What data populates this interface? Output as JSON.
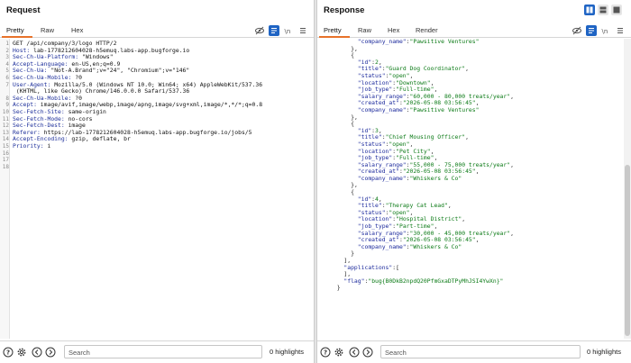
{
  "request": {
    "title": "Request",
    "tabs": [
      "Pretty",
      "Raw",
      "Hex"
    ],
    "line_numbers": [
      "1",
      "2",
      "3",
      "4",
      "5",
      "6",
      "7",
      "",
      "8",
      "9",
      "10",
      "11",
      "12",
      "13",
      "14",
      "15",
      "16",
      "17",
      "18"
    ],
    "lines": [
      {
        "k": "",
        "v": "GET /api/company/3/logo HTTP/2"
      },
      {
        "k": "Host",
        "v": " lab-1778212604028-h5emuq.labs-app.bugforge.io"
      },
      {
        "k": "Sec-Ch-Ua-Platform",
        "v": " \"Windows\""
      },
      {
        "k": "Accept-Language",
        "v": " en-US,en;q=0.9"
      },
      {
        "k": "Sec-Ch-Ua",
        "v": " \"Not-A.Brand\";v=\"24\", \"Chromium\";v=\"146\""
      },
      {
        "k": "Sec-Ch-Ua-Mobile",
        "v": " ?0"
      },
      {
        "k": "User-Agent",
        "v": " Mozilla/5.0 (Windows NT 10.0; Win64; x64) AppleWebKit/537.36"
      },
      {
        "k": "",
        "v": " (KHTML, like Gecko) Chrome/146.0.0.0 Safari/537.36"
      },
      {
        "k": "Sec-Ch-Ua-Mobile",
        "v": " ?0"
      },
      {
        "k": "Accept",
        "v": " image/avif,image/webp,image/apng,image/svg+xml,image/*,*/*;q=0.8"
      },
      {
        "k": "Sec-Fetch-Site",
        "v": " same-origin"
      },
      {
        "k": "Sec-Fetch-Mode",
        "v": " no-cors"
      },
      {
        "k": "Sec-Fetch-Dest",
        "v": " image"
      },
      {
        "k": "Referer",
        "v": " https://lab-1778212604028-h5emuq.labs-app.bugforge.io/jobs/5"
      },
      {
        "k": "Accept-Encoding",
        "v": " gzip, deflate, br"
      },
      {
        "k": "Priority",
        "v": " i"
      },
      {
        "k": "",
        "v": ""
      },
      {
        "k": "",
        "v": ""
      },
      {
        "k": "",
        "v": ""
      }
    ],
    "search_placeholder": "Search",
    "highlights": "0 highlights"
  },
  "response": {
    "title": "Response",
    "tabs": [
      "Pretty",
      "Raw",
      "Hex",
      "Render"
    ],
    "json_lines": [
      [
        [
          "i",
          "        "
        ],
        [
          "k",
          "\"company_name\""
        ],
        [
          "p",
          ":"
        ],
        [
          "s",
          "\"Pawsitive Ventures\""
        ]
      ],
      [
        [
          "i",
          "      "
        ],
        [
          "p",
          "},"
        ]
      ],
      [
        [
          "i",
          "      "
        ],
        [
          "p",
          "{"
        ]
      ],
      [
        [
          "i",
          "        "
        ],
        [
          "k",
          "\"id\""
        ],
        [
          "p",
          ":"
        ],
        [
          "n",
          "2"
        ],
        [
          "p",
          ","
        ]
      ],
      [
        [
          "i",
          "        "
        ],
        [
          "k",
          "\"title\""
        ],
        [
          "p",
          ":"
        ],
        [
          "s",
          "\"Guard Dog Coordinator\""
        ],
        [
          "p",
          ","
        ]
      ],
      [
        [
          "i",
          "        "
        ],
        [
          "k",
          "\"status\""
        ],
        [
          "p",
          ":"
        ],
        [
          "s",
          "\"open\""
        ],
        [
          "p",
          ","
        ]
      ],
      [
        [
          "i",
          "        "
        ],
        [
          "k",
          "\"location\""
        ],
        [
          "p",
          ":"
        ],
        [
          "s",
          "\"Downtown\""
        ],
        [
          "p",
          ","
        ]
      ],
      [
        [
          "i",
          "        "
        ],
        [
          "k",
          "\"job_type\""
        ],
        [
          "p",
          ":"
        ],
        [
          "s",
          "\"Full-time\""
        ],
        [
          "p",
          ","
        ]
      ],
      [
        [
          "i",
          "        "
        ],
        [
          "k",
          "\"salary_range\""
        ],
        [
          "p",
          ":"
        ],
        [
          "s",
          "\"60,000 - 80,000 treats/year\""
        ],
        [
          "p",
          ","
        ]
      ],
      [
        [
          "i",
          "        "
        ],
        [
          "k",
          "\"created_at\""
        ],
        [
          "p",
          ":"
        ],
        [
          "s",
          "\"2026-05-08 03:56:45\""
        ],
        [
          "p",
          ","
        ]
      ],
      [
        [
          "i",
          "        "
        ],
        [
          "k",
          "\"company_name\""
        ],
        [
          "p",
          ":"
        ],
        [
          "s",
          "\"Pawsitive Ventures\""
        ]
      ],
      [
        [
          "i",
          "      "
        ],
        [
          "p",
          "},"
        ]
      ],
      [
        [
          "i",
          "      "
        ],
        [
          "p",
          "{"
        ]
      ],
      [
        [
          "i",
          "        "
        ],
        [
          "k",
          "\"id\""
        ],
        [
          "p",
          ":"
        ],
        [
          "n",
          "3"
        ],
        [
          "p",
          ","
        ]
      ],
      [
        [
          "i",
          "        "
        ],
        [
          "k",
          "\"title\""
        ],
        [
          "p",
          ":"
        ],
        [
          "s",
          "\"Chief Mousing Officer\""
        ],
        [
          "p",
          ","
        ]
      ],
      [
        [
          "i",
          "        "
        ],
        [
          "k",
          "\"status\""
        ],
        [
          "p",
          ":"
        ],
        [
          "s",
          "\"open\""
        ],
        [
          "p",
          ","
        ]
      ],
      [
        [
          "i",
          "        "
        ],
        [
          "k",
          "\"location\""
        ],
        [
          "p",
          ":"
        ],
        [
          "s",
          "\"Pet City\""
        ],
        [
          "p",
          ","
        ]
      ],
      [
        [
          "i",
          "        "
        ],
        [
          "k",
          "\"job_type\""
        ],
        [
          "p",
          ":"
        ],
        [
          "s",
          "\"Full-time\""
        ],
        [
          "p",
          ","
        ]
      ],
      [
        [
          "i",
          "        "
        ],
        [
          "k",
          "\"salary_range\""
        ],
        [
          "p",
          ":"
        ],
        [
          "s",
          "\"55,000 - 75,000 treats/year\""
        ],
        [
          "p",
          ","
        ]
      ],
      [
        [
          "i",
          "        "
        ],
        [
          "k",
          "\"created_at\""
        ],
        [
          "p",
          ":"
        ],
        [
          "s",
          "\"2026-05-08 03:56:45\""
        ],
        [
          "p",
          ","
        ]
      ],
      [
        [
          "i",
          "        "
        ],
        [
          "k",
          "\"company_name\""
        ],
        [
          "p",
          ":"
        ],
        [
          "s",
          "\"Whiskers & Co\""
        ]
      ],
      [
        [
          "i",
          "      "
        ],
        [
          "p",
          "},"
        ]
      ],
      [
        [
          "i",
          "      "
        ],
        [
          "p",
          "{"
        ]
      ],
      [
        [
          "i",
          "        "
        ],
        [
          "k",
          "\"id\""
        ],
        [
          "p",
          ":"
        ],
        [
          "n",
          "4"
        ],
        [
          "p",
          ","
        ]
      ],
      [
        [
          "i",
          "        "
        ],
        [
          "k",
          "\"title\""
        ],
        [
          "p",
          ":"
        ],
        [
          "s",
          "\"Therapy Cat Lead\""
        ],
        [
          "p",
          ","
        ]
      ],
      [
        [
          "i",
          "        "
        ],
        [
          "k",
          "\"status\""
        ],
        [
          "p",
          ":"
        ],
        [
          "s",
          "\"open\""
        ],
        [
          "p",
          ","
        ]
      ],
      [
        [
          "i",
          "        "
        ],
        [
          "k",
          "\"location\""
        ],
        [
          "p",
          ":"
        ],
        [
          "s",
          "\"Hospital District\""
        ],
        [
          "p",
          ","
        ]
      ],
      [
        [
          "i",
          "        "
        ],
        [
          "k",
          "\"job_type\""
        ],
        [
          "p",
          ":"
        ],
        [
          "s",
          "\"Part-time\""
        ],
        [
          "p",
          ","
        ]
      ],
      [
        [
          "i",
          "        "
        ],
        [
          "k",
          "\"salary_range\""
        ],
        [
          "p",
          ":"
        ],
        [
          "s",
          "\"30,000 - 45,000 treats/year\""
        ],
        [
          "p",
          ","
        ]
      ],
      [
        [
          "i",
          "        "
        ],
        [
          "k",
          "\"created_at\""
        ],
        [
          "p",
          ":"
        ],
        [
          "s",
          "\"2026-05-08 03:56:45\""
        ],
        [
          "p",
          ","
        ]
      ],
      [
        [
          "i",
          "        "
        ],
        [
          "k",
          "\"company_name\""
        ],
        [
          "p",
          ":"
        ],
        [
          "s",
          "\"Whiskers & Co\""
        ]
      ],
      [
        [
          "i",
          "      "
        ],
        [
          "p",
          "}"
        ]
      ],
      [
        [
          "i",
          "    "
        ],
        [
          "p",
          "],"
        ]
      ],
      [
        [
          "i",
          "    "
        ],
        [
          "k",
          "\"applications\""
        ],
        [
          "p",
          ":["
        ]
      ],
      [
        [
          "i",
          "    "
        ],
        [
          "p",
          "],"
        ]
      ],
      [
        [
          "i",
          "    "
        ],
        [
          "k",
          "\"flag\""
        ],
        [
          "p",
          ":"
        ],
        [
          "s",
          "\"bug{B0DkB2npdQ20PfmGxaDTPyMhJSI4YwXn}\""
        ]
      ],
      [
        [
          "i",
          "  "
        ],
        [
          "p",
          "}"
        ]
      ]
    ],
    "search_placeholder": "Search",
    "highlights": "0 highlights"
  },
  "colors": {
    "accent": "#e8722a",
    "selected_icon": "#1f64c4",
    "json_key": "#1c2a9c",
    "json_string": "#0b7a16"
  },
  "icons": [
    "eye-slash-icon",
    "wrap-lines-icon",
    "newline-icon",
    "menu-icon",
    "help-icon",
    "settings-icon",
    "back-arrow-icon",
    "forward-arrow-icon",
    "layout-horizontal-icon",
    "layout-vertical-icon",
    "layout-single-icon"
  ]
}
